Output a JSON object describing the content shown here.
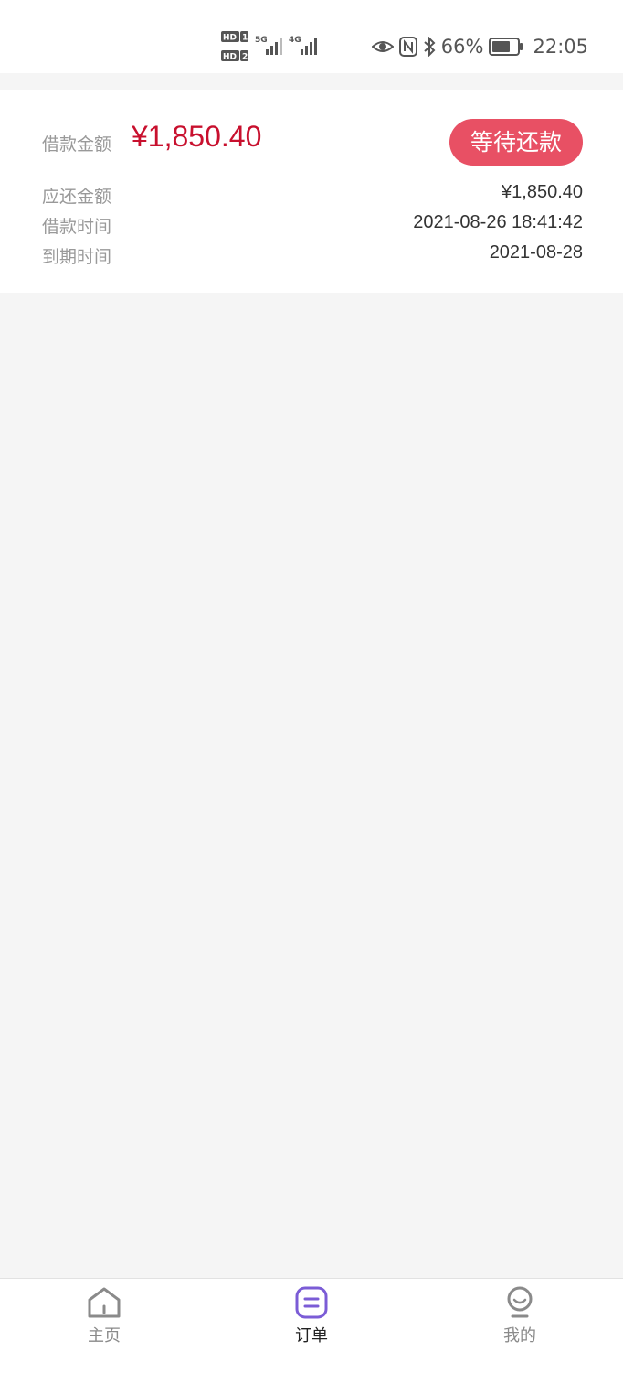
{
  "status_bar": {
    "sim1": "HD 1",
    "sim2": "HD 2",
    "net1": "5G",
    "net2": "4G",
    "battery": "66%",
    "time": "22:05"
  },
  "order": {
    "loan_amount_label": "借款金额",
    "loan_amount": "¥1,850.40",
    "status": "等待还款",
    "rows": [
      {
        "label": "应还金额",
        "value": "¥1,850.40"
      },
      {
        "label": "借款时间",
        "value": "2021-08-26 18:41:42"
      },
      {
        "label": "到期时间",
        "value": "2021-08-28"
      }
    ]
  },
  "nav": {
    "items": [
      {
        "label": "主页",
        "icon": "home-icon",
        "active": false
      },
      {
        "label": "订单",
        "icon": "order-icon",
        "active": true
      },
      {
        "label": "我的",
        "icon": "profile-icon",
        "active": false
      }
    ],
    "active_color": "#7b5cd6",
    "inactive_color": "#8a8a8a"
  },
  "colors": {
    "amount_red": "#c8102e",
    "pill_bg": "#e85064",
    "page_bg": "#f5f5f5"
  }
}
